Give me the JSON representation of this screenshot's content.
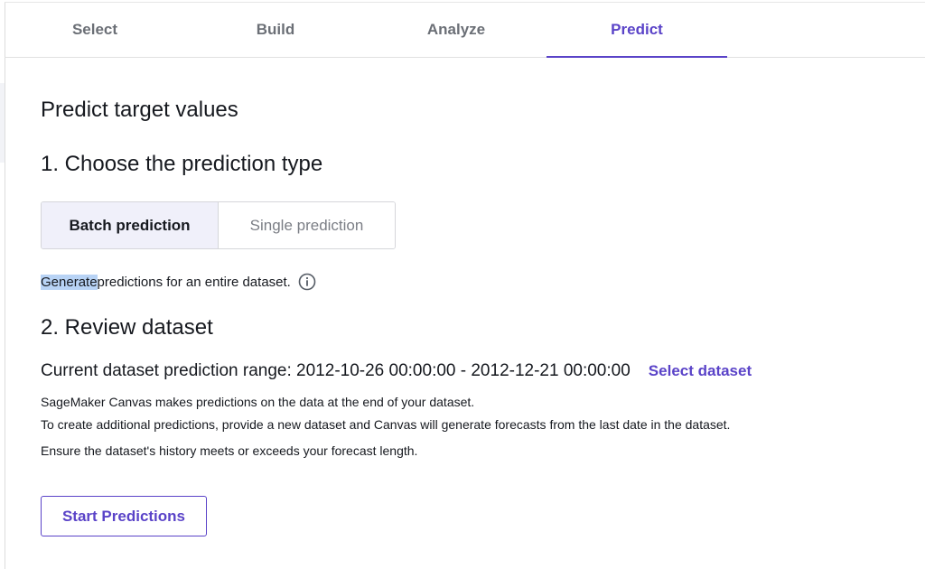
{
  "tabs": [
    {
      "label": "Select"
    },
    {
      "label": "Build"
    },
    {
      "label": "Analyze"
    },
    {
      "label": "Predict"
    }
  ],
  "active_tab": "Predict",
  "page_title": "Predict target values",
  "section1": {
    "title": "1. Choose the prediction type",
    "options": [
      {
        "label": "Batch prediction",
        "selected": true
      },
      {
        "label": "Single prediction",
        "selected": false
      }
    ],
    "description_highlight": "Generate",
    "description_rest": " predictions for an entire dataset."
  },
  "section2": {
    "title": "2. Review dataset",
    "range_text": "Current dataset prediction range: 2012-10-26 00:00:00 - 2012-12-21 00:00:00",
    "select_dataset_label": "Select dataset",
    "notes": [
      "SageMaker Canvas makes predictions on the data at the end of your dataset.",
      "To create additional predictions, provide a new dataset and Canvas will generate forecasts from the last date in the dataset.",
      "Ensure the dataset's history meets or exceeds your forecast length."
    ]
  },
  "start_button_label": "Start Predictions",
  "colors": {
    "accent": "#5a43c8",
    "selected_segment_bg": "#f0f0fa",
    "text_highlight": "#b8d3f5"
  },
  "icons": {
    "info": "info-icon"
  }
}
